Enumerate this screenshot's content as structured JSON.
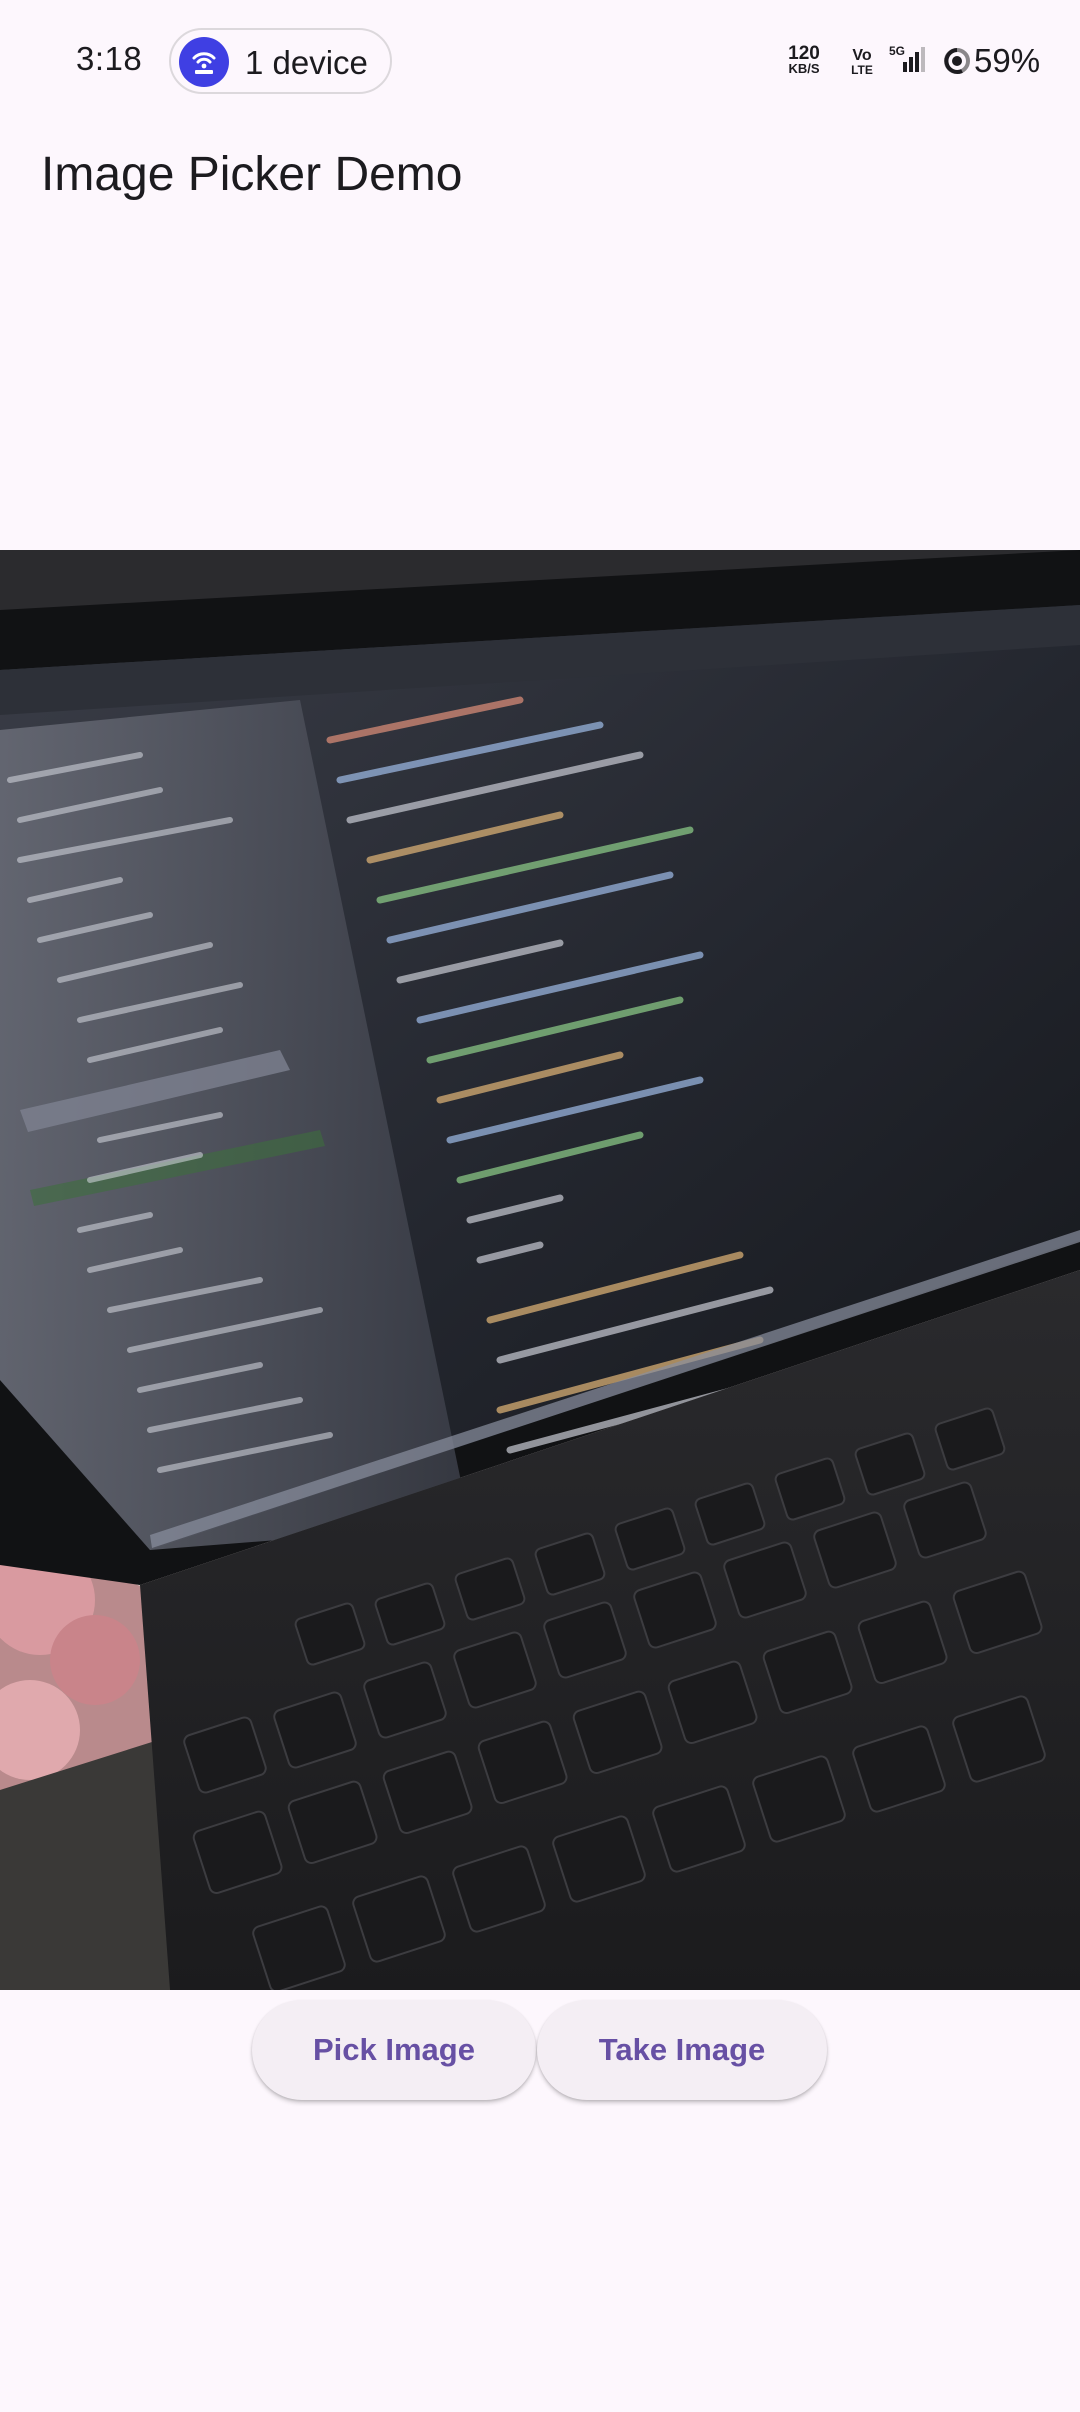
{
  "status_bar": {
    "time": "3:18",
    "device_chip": {
      "label": "1 device",
      "icon": "hotspot-icon",
      "icon_color": "#3f3fe3"
    },
    "net_speed_value": "120",
    "net_speed_unit": "KB/S",
    "volte_top": "Vo",
    "volte_bottom": "LTE",
    "network_type": "5G",
    "battery_percent": "59%"
  },
  "app_bar": {
    "title": "Image Picker Demo"
  },
  "picked_image": {
    "description_icon": "photo-image",
    "present": true
  },
  "buttons": {
    "pick_image": "Pick Image",
    "take_image": "Take Image"
  },
  "colors": {
    "background": "#fdf7fd",
    "button_text": "#6750a4",
    "button_surface": "#f4eef4"
  }
}
